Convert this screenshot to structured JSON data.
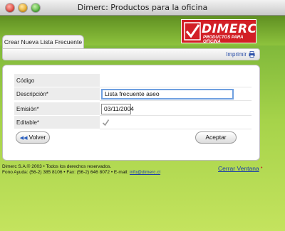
{
  "window": {
    "title": "Dimerc: Productos para la oficina"
  },
  "brand": {
    "name": "DIMERC",
    "tagline": "PRODUCTOS PARA OFICINA",
    "color": "#d21f26"
  },
  "tab": {
    "label": "Crear Nueva Lista Frecuente"
  },
  "toolbar": {
    "print_label": "Imprimir"
  },
  "form": {
    "codigo_label": "Código",
    "codigo_value": "",
    "descripcion_label": "Descripción*",
    "descripcion_value": "Lista frecuente aseo",
    "emision_label": "Emisión*",
    "emision_value": "03/11/2004",
    "editable_label": "Editable*",
    "editable_checked": true
  },
  "buttons": {
    "back_label": "Volver",
    "accept_label": "Aceptar"
  },
  "footer": {
    "copyright": "Dimerc S.A.© 2003 • Todos los derechos reservados.",
    "contact_prefix": "Fono Ayuda: (56-2) 385 8106 • Fax: (56-2) 646 8072 • E-mail: ",
    "email": "info@dimerc.cl",
    "close_label": "Cerrar Ventana"
  }
}
